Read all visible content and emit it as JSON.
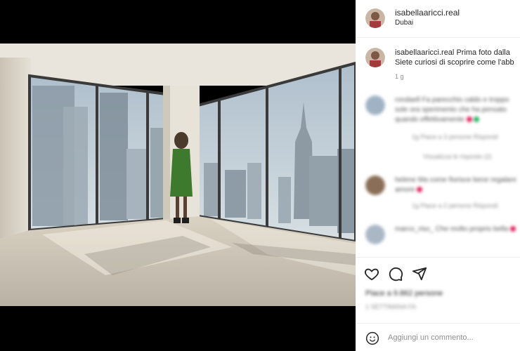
{
  "post": {
    "username": "isabellaaricci.real",
    "location": "Dubai",
    "caption_user": "isabellaaricci.real",
    "caption_line1": "Prima foto dalla",
    "caption_line2": "Siete curiosi di scoprire come l'abb",
    "time": "1 g",
    "photo_alt": "apartment-window-photo"
  },
  "comments": [
    {
      "text": "rondaell Fa parecchio caldo e troppo sole ora sperimento che ha pensato quando effettivamente",
      "meta": "1g   Piace a 3 persone   Rispondi",
      "replies": "Visualizza le risposte (2)"
    },
    {
      "text": "helene Ma come fiorisce bene regalare amore",
      "meta": "1g   Piace a 2 persone   Rispondi"
    },
    {
      "text": "marco_riso_ Che molto proprio bella",
      "meta": ""
    }
  ],
  "actions": {
    "likes": "Piace a 9.862 persone",
    "date": "1 SETTIMANA FA"
  },
  "compose": {
    "placeholder": "Aggiungi un commento..."
  }
}
